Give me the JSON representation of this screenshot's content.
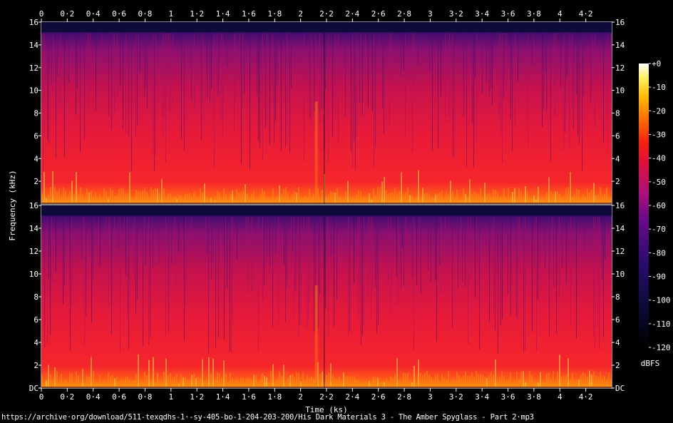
{
  "chart_data": {
    "type": "heatmap",
    "title": "",
    "xlabel": "Time (ks)",
    "ylabel": "Frequency (kHz)",
    "xlim": [
      0,
      4.4
    ],
    "ylim": [
      0,
      16
    ],
    "x_ticks": [
      "0",
      "0·2",
      "0·4",
      "0·6",
      "0·8",
      "1",
      "1·2",
      "1·4",
      "1·6",
      "1·8",
      "2",
      "2·2",
      "2·4",
      "2·6",
      "2·8",
      "3",
      "3·2",
      "3·4",
      "3·6",
      "3·8",
      "4",
      "4·2"
    ],
    "x_tick_values": [
      0,
      0.2,
      0.4,
      0.6,
      0.8,
      1.0,
      1.2,
      1.4,
      1.6,
      1.8,
      2.0,
      2.2,
      2.4,
      2.6,
      2.8,
      3.0,
      3.2,
      3.4,
      3.6,
      3.8,
      4.0,
      4.2
    ],
    "y_ticks_top": [
      "16",
      "14",
      "12",
      "10",
      "8",
      "6",
      "4",
      "2"
    ],
    "y_ticks_bottom": [
      "16",
      "14",
      "12",
      "10",
      "8",
      "6",
      "4",
      "2",
      "DC"
    ],
    "y_tick_values": [
      16,
      14,
      12,
      10,
      8,
      6,
      4,
      2,
      0
    ],
    "channels": 2,
    "colorbar": {
      "label": "dBFS",
      "ticks": [
        "+0",
        "-10",
        "-20",
        "-30",
        "-40",
        "-50",
        "-60",
        "-70",
        "-80",
        "-90",
        "-100",
        "-110",
        "-120"
      ],
      "tick_values": [
        0,
        -10,
        -20,
        -30,
        -40,
        -50,
        -60,
        -70,
        -80,
        -90,
        -100,
        -110,
        -120
      ],
      "range": [
        -120,
        0
      ]
    },
    "source": "https://archive·org/download/511-texqdhs-1·-sy-405-bo-1-204-203-200/His Dark Materials 3 - The Amber Spyglass - Part 2·mp3"
  }
}
